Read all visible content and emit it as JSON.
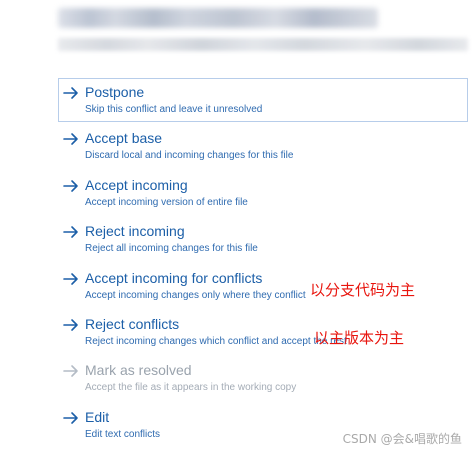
{
  "options": [
    {
      "title": "Postpone",
      "desc": "Skip this conflict and leave it unresolved",
      "selected": true,
      "enabled": true
    },
    {
      "title": "Accept base",
      "desc": "Discard local and incoming changes for this file",
      "selected": false,
      "enabled": true
    },
    {
      "title": "Accept incoming",
      "desc": "Accept incoming version of entire file",
      "selected": false,
      "enabled": true
    },
    {
      "title": "Reject incoming",
      "desc": "Reject all incoming changes for this file",
      "selected": false,
      "enabled": true
    },
    {
      "title": "Accept incoming for conflicts",
      "desc": "Accept incoming changes only where they conflict",
      "selected": false,
      "enabled": true
    },
    {
      "title": "Reject conflicts",
      "desc": "Reject incoming changes which conflict and accept the rest",
      "selected": false,
      "enabled": true
    },
    {
      "title": "Mark as resolved",
      "desc": "Accept the file as it appears in the working copy",
      "selected": false,
      "enabled": false
    },
    {
      "title": "Edit",
      "desc": "Edit text conflicts",
      "selected": false,
      "enabled": true
    }
  ],
  "annotations": {
    "accept_incoming_for_conflicts_note": "以分支代码为主",
    "reject_conflicts_note": "以主版本为主"
  },
  "watermark": "CSDN @会&唱歌的鱼",
  "colors": {
    "link_blue": "#1c5fa8",
    "desc_blue": "#2f6bb0",
    "disabled_gray": "#9aa3ad",
    "selection_border": "#b7cdea",
    "annotation_red": "#e8150e",
    "watermark_gray": "#a9a9a9"
  },
  "icons": {
    "option_arrow": "arrow-right-icon"
  }
}
